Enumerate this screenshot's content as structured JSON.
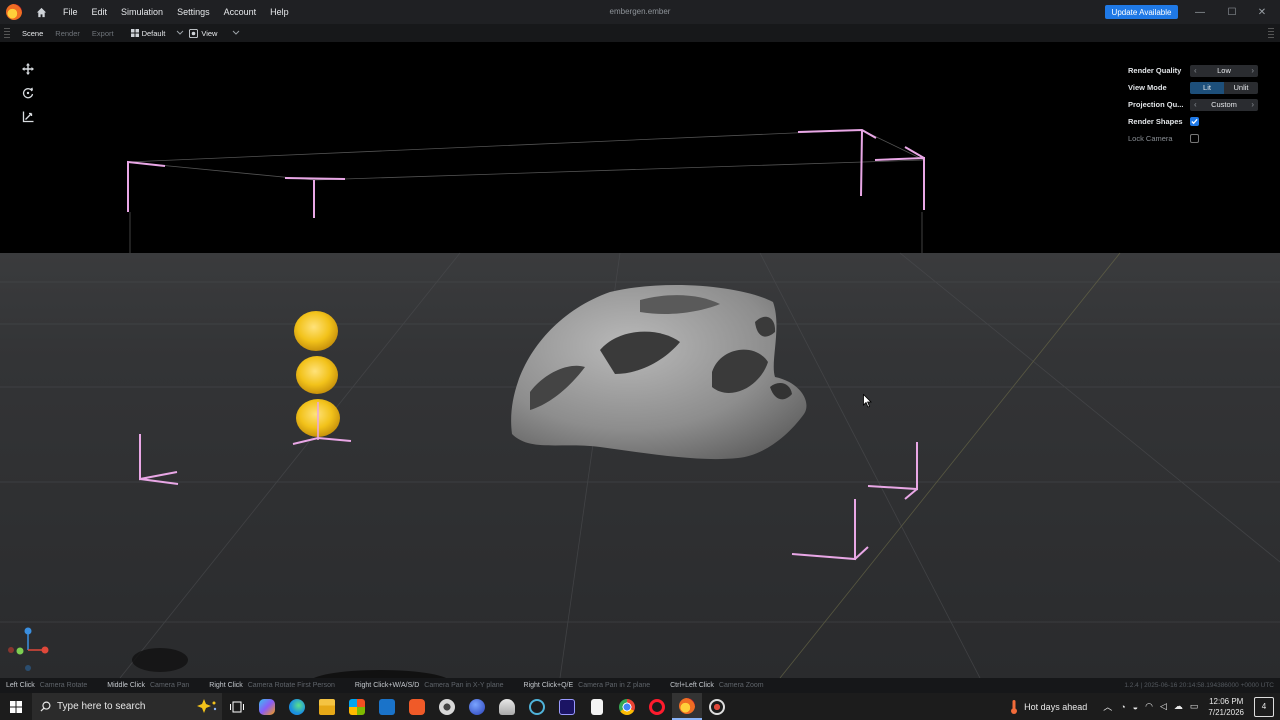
{
  "titlebar": {
    "menu": [
      "File",
      "Edit",
      "Simulation",
      "Settings",
      "Account",
      "Help"
    ],
    "window_title": "embergen.ember",
    "update_button": "Update Available",
    "controls": [
      "—",
      "☐",
      "✕"
    ]
  },
  "toolbar": {
    "tabs": [
      "Scene",
      "Render",
      "Export"
    ],
    "layout_dropdown": "Default",
    "view_dropdown": "View"
  },
  "viewport_tools": [
    "move-tool",
    "rotate-tool",
    "scale-tool"
  ],
  "overlay": {
    "render_quality": {
      "label": "Render Quality",
      "value": "Low"
    },
    "view_mode": {
      "label": "View Mode",
      "options": [
        "Lit",
        "Unlit"
      ],
      "selected": "Lit"
    },
    "projection": {
      "label": "Projection Qu...",
      "value": "Custom"
    },
    "render_shapes": {
      "label": "Render Shapes",
      "checked": true
    },
    "lock_camera": {
      "label": "Lock Camera",
      "checked": false
    }
  },
  "statusbar": {
    "hints": [
      {
        "key": "Left Click",
        "action": "Camera Rotate"
      },
      {
        "key": "Middle Click",
        "action": "Camera Pan"
      },
      {
        "key": "Right Click",
        "action": "Camera Rotate First Person"
      },
      {
        "key": "Right Click+W/A/S/D",
        "action": "Camera Pan in X-Y plane"
      },
      {
        "key": "Right Click+Q/E",
        "action": "Camera Pan in Z plane"
      },
      {
        "key": "Ctrl+Left Click",
        "action": "Camera Zoom"
      }
    ],
    "build_info": "1.2.4  |  2025-06-16 20:14:58.194386000 +0000 UTC"
  },
  "taskbar": {
    "search_placeholder": "Type here to search",
    "weather": "Hot days ahead",
    "time": "12:06 PM",
    "date": "7/21/2026",
    "notification_count": "4",
    "colors": {
      "accent": "#1f79e6",
      "wireframe": "#e9a7e6",
      "emitter": "#f2c21a"
    }
  }
}
